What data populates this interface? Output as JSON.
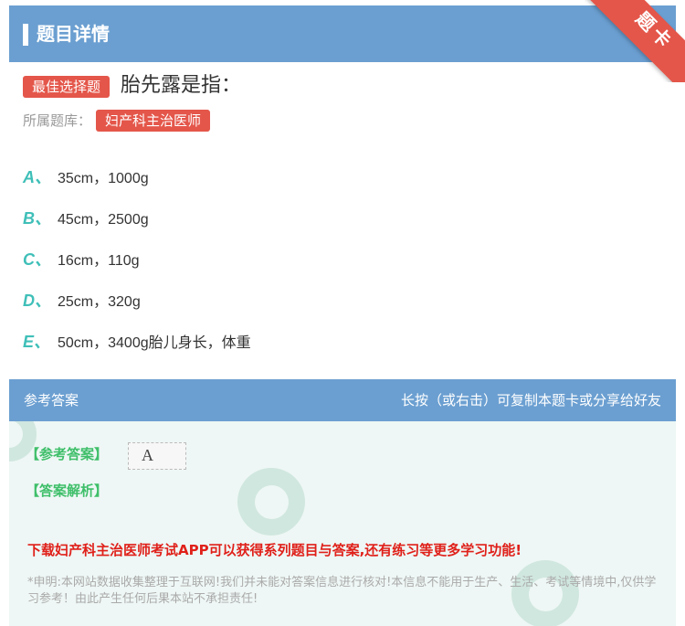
{
  "header": {
    "title": "题目详情",
    "corner_label": "题卡"
  },
  "question": {
    "type_badge": "最佳选择题",
    "stem": "胎先露是指：",
    "bank_label": "所属题库：",
    "bank_name": "妇产科主治医师",
    "options": [
      {
        "letter": "A、",
        "text": "35cm，1000g"
      },
      {
        "letter": "B、",
        "text": "45cm，2500g"
      },
      {
        "letter": "C、",
        "text": "16cm，110g"
      },
      {
        "letter": "D、",
        "text": "25cm，320g"
      },
      {
        "letter": "E、",
        "text": "50cm，3400g胎儿身长，体重"
      }
    ]
  },
  "answer": {
    "header_left": "参考答案",
    "header_right": "长按（或右击）可复制本题卡或分享给好友",
    "answer_label": "【参考答案】",
    "answer_value": "A",
    "analysis_label": "【答案解析】",
    "promo": "下载妇产科主治医师考试APP可以获得系列题目与答案,还有练习等更多学习功能!",
    "disclaimer": "*申明:本网站数据收集整理于互联网!我们并未能对答案信息进行核对!本信息不能用于生产、生活、考试等情境中,仅供学习参考！由此产生任何后果本站不承担责任!"
  },
  "colors": {
    "header_bg": "#6b9fd1",
    "badge": "#e4564a",
    "option_letter": "#3fbfb8",
    "answer_label": "#3fbf6a",
    "promo": "#e0201a"
  }
}
